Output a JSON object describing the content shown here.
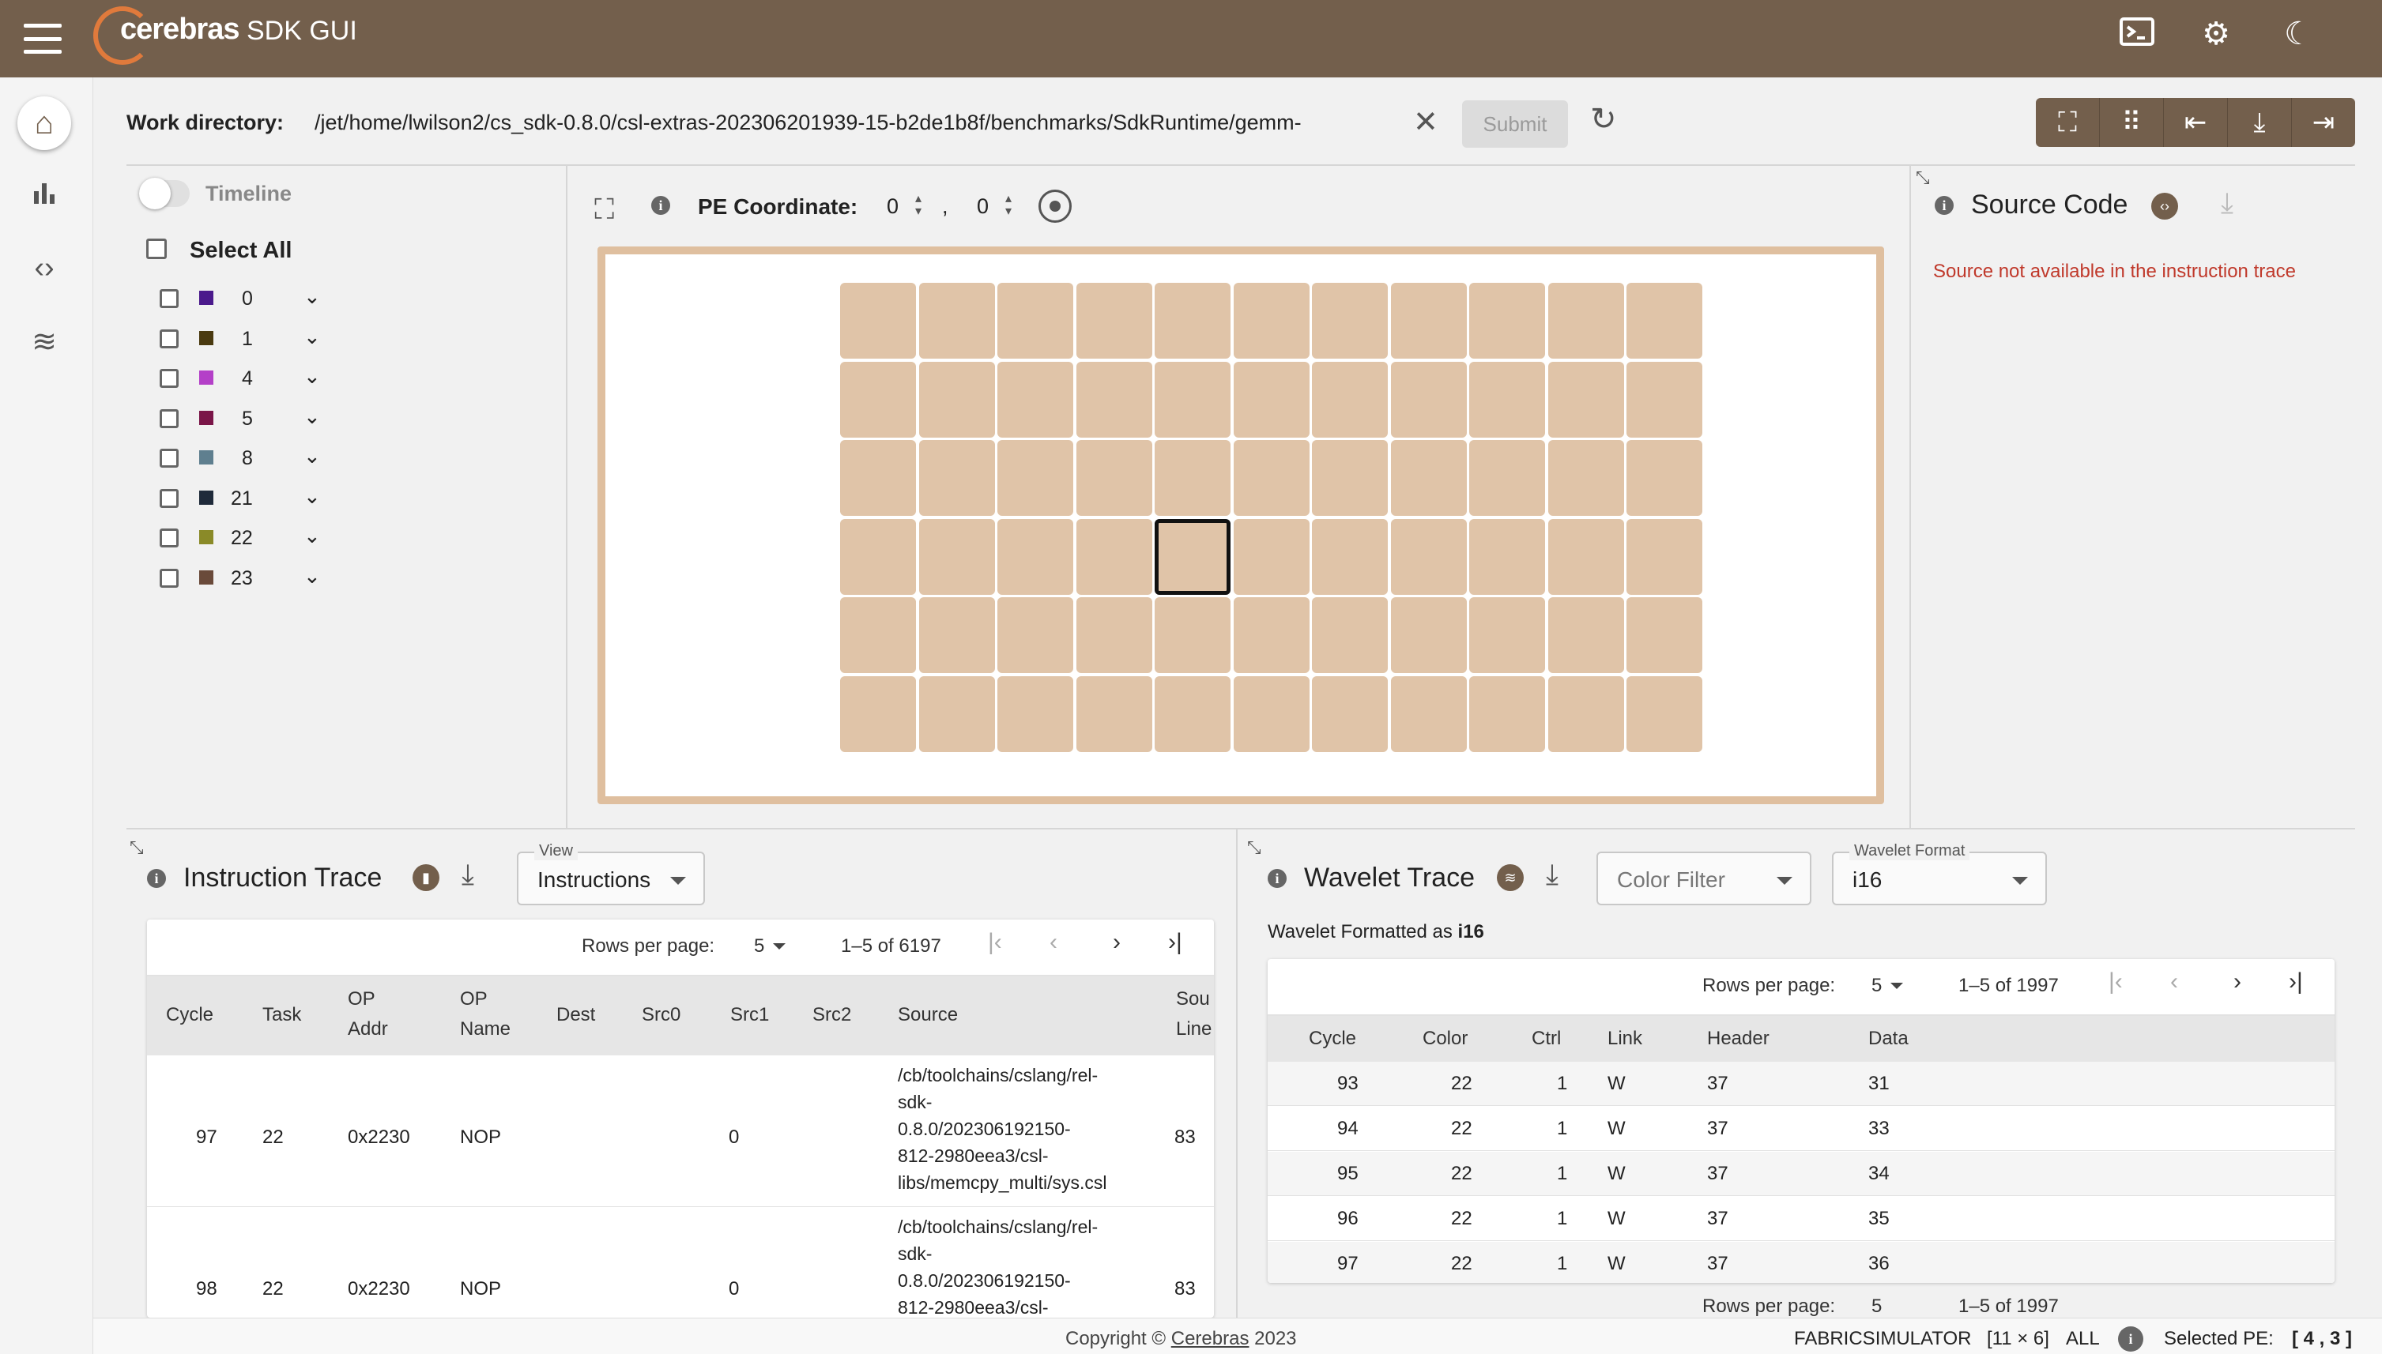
{
  "app": {
    "brand": "cerebras",
    "title": "SDK GUI"
  },
  "workdir": {
    "label": "Work directory:",
    "path": "/jet/home/lwilson2/cs_sdk-0.8.0/csl-extras-202306201939-15-b2de1b8f/benchmarks/SdkRuntime/gemm-",
    "submit": "Submit"
  },
  "timeline": {
    "label": "Timeline"
  },
  "colors": {
    "select_all": "Select All",
    "items": [
      {
        "num": "0",
        "color": "#4b1a8c"
      },
      {
        "num": "1",
        "color": "#4a3a10"
      },
      {
        "num": "4",
        "color": "#b440c8"
      },
      {
        "num": "5",
        "color": "#7a1548"
      },
      {
        "num": "8",
        "color": "#5f7f8f"
      },
      {
        "num": "21",
        "color": "#1f2a3a"
      },
      {
        "num": "22",
        "color": "#8a8a28"
      },
      {
        "num": "23",
        "color": "#6a4a3a"
      }
    ]
  },
  "pe": {
    "label": "PE Coordinate:",
    "x": "0",
    "y": "0",
    "comma": ","
  },
  "source": {
    "title": "Source Code",
    "message": "Source not available in the instruction trace"
  },
  "instruction_trace": {
    "title": "Instruction Trace",
    "view_label": "View",
    "view_value": "Instructions",
    "rows_per_page_label": "Rows per page:",
    "rows_per_page": "5",
    "range": "1–5 of 6197",
    "headers": [
      "Cycle",
      "Task",
      "OP\nAddr",
      "OP\nName",
      "Dest",
      "Src0",
      "Src1",
      "Src2",
      "Source",
      "Sou\nLine"
    ],
    "rows": [
      {
        "cycle": "97",
        "task": "22",
        "addr": "0x2230",
        "name": "NOP",
        "src1": "0",
        "source": "/cb/toolchains/cslang/rel-\nsdk-\n0.8.0/202306192150-\n812-2980eea3/csl-\nlibs/memcpy_multi/sys.csl",
        "line": "83"
      },
      {
        "cycle": "98",
        "task": "22",
        "addr": "0x2230",
        "name": "NOP",
        "src1": "0",
        "source": "/cb/toolchains/cslang/rel-\nsdk-\n0.8.0/202306192150-\n812-2980eea3/csl-",
        "line": "83"
      }
    ]
  },
  "wavelet_trace": {
    "title": "Wavelet Trace",
    "color_filter": "Color Filter",
    "format_label": "Wavelet Format",
    "format_value": "i16",
    "formatted_as_prefix": "Wavelet Formatted as ",
    "formatted_as_value": "i16",
    "rows_per_page_label": "Rows per page:",
    "rows_per_page": "5",
    "range": "1–5 of 1997",
    "headers": [
      "Cycle",
      "Color",
      "Ctrl",
      "Link",
      "Header",
      "Data"
    ],
    "rows": [
      {
        "cycle": "93",
        "color": "22",
        "ctrl": "1",
        "link": "W",
        "header": "37",
        "data": "31"
      },
      {
        "cycle": "94",
        "color": "22",
        "ctrl": "1",
        "link": "W",
        "header": "37",
        "data": "33"
      },
      {
        "cycle": "95",
        "color": "22",
        "ctrl": "1",
        "link": "W",
        "header": "37",
        "data": "34"
      },
      {
        "cycle": "96",
        "color": "22",
        "ctrl": "1",
        "link": "W",
        "header": "37",
        "data": "35"
      },
      {
        "cycle": "97",
        "color": "22",
        "ctrl": "1",
        "link": "W",
        "header": "37",
        "data": "36"
      }
    ]
  },
  "footer": {
    "copyright_prefix": "Copyright © ",
    "company": "Cerebras",
    "year": "2023",
    "mode": "FABRICSIMULATOR",
    "dims": "[11 × 6]",
    "all": "ALL",
    "selected_label": "Selected PE:",
    "selected_value": "[ 4 , 3 ]"
  },
  "grid": {
    "cols": 11,
    "rows": 6,
    "selected": [
      4,
      3
    ]
  }
}
